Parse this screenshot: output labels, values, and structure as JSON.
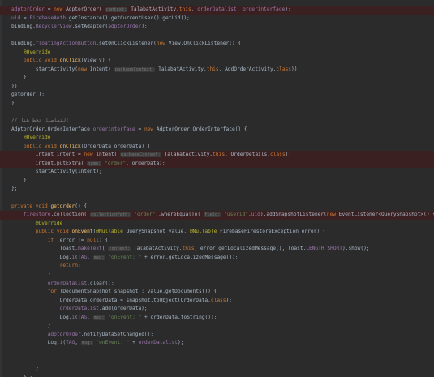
{
  "editor": {
    "lines": [
      [
        [
          "fld",
          "adptorOrder"
        ],
        [
          "p",
          " = "
        ],
        [
          "kw",
          "new "
        ],
        [
          "p",
          "AdptorOrder( "
        ],
        [
          "hint",
          "context:"
        ],
        [
          "p",
          " TalabatActivity."
        ],
        [
          "kw",
          "this"
        ],
        [
          "p",
          ", "
        ],
        [
          "fld",
          "orderDatalist"
        ],
        [
          "p",
          ", "
        ],
        [
          "fld",
          "orderinterface"
        ],
        [
          "p",
          ");"
        ]
      ],
      [
        [
          "fld",
          "uid"
        ],
        [
          "p",
          " = "
        ],
        [
          "fld",
          "FirebaseAuth"
        ],
        [
          "p",
          "."
        ],
        [
          "fn",
          ""
        ],
        [
          "p",
          "getInstance().getCurrentUser().getUid();"
        ]
      ],
      [
        [
          "p",
          "binding."
        ],
        [
          "fld",
          "RecyclerView"
        ],
        [
          "p",
          ".setAdapter("
        ],
        [
          "fld",
          "adptorOrder"
        ],
        [
          "p",
          ");"
        ]
      ],
      [
        [
          "p",
          ""
        ]
      ],
      [
        [
          "p",
          "binding."
        ],
        [
          "fld",
          "floatingActionButton"
        ],
        [
          "p",
          ".setOnClickListener("
        ],
        [
          "kw",
          "new "
        ],
        [
          "p",
          "View.OnClickListener() {"
        ]
      ],
      [
        [
          "ann",
          "    @Override"
        ]
      ],
      [
        [
          "kw",
          "    public void "
        ],
        [
          "fn",
          "onClick"
        ],
        [
          "p",
          "(View v) {"
        ]
      ],
      [
        [
          "p",
          "        startActivity("
        ],
        [
          "kw",
          "new "
        ],
        [
          "p",
          "Intent( "
        ],
        [
          "hint",
          "packageContext:"
        ],
        [
          "p",
          " TalabatActivity."
        ],
        [
          "kw",
          "this"
        ],
        [
          "p",
          ", AddOrderActivity."
        ],
        [
          "kw",
          "class"
        ],
        [
          "p",
          "));"
        ]
      ],
      [
        [
          "p",
          "    }"
        ]
      ],
      [
        [
          "p",
          "});"
        ]
      ],
      [
        [
          "p",
          "getorder();"
        ],
        [
          "caret",
          ""
        ]
      ],
      [
        [
          "p",
          "}"
        ]
      ],
      [
        [
          "p",
          ""
        ]
      ],
      [
        [
          "cmt",
          "// التفاصيل تحط هنا"
        ]
      ],
      [
        [
          "p",
          "AdptorOrder.OrderInterface "
        ],
        [
          "fld",
          "orderinterface"
        ],
        [
          "p",
          " = "
        ],
        [
          "kw",
          "new "
        ],
        [
          "p",
          "AdptorOrder.OrderInterface() {"
        ]
      ],
      [
        [
          "ann",
          "    @Override"
        ]
      ],
      [
        [
          "kw",
          "    public void "
        ],
        [
          "fn",
          "onClick"
        ],
        [
          "p",
          "(OrderData orderData) {"
        ]
      ],
      [
        [
          "p",
          "        Intent intent = "
        ],
        [
          "kw",
          "new "
        ],
        [
          "p",
          "Intent( "
        ],
        [
          "hint",
          "packageContext:"
        ],
        [
          "p",
          " TalabatActivity."
        ],
        [
          "kw",
          "this"
        ],
        [
          "p",
          ", OrderDetails."
        ],
        [
          "kw",
          "class"
        ],
        [
          "p",
          ");"
        ]
      ],
      [
        [
          "p",
          "        intent.putExtra( "
        ],
        [
          "hint",
          "name:"
        ],
        [
          "str",
          " \"order\""
        ],
        [
          "p",
          ", orderData);"
        ]
      ],
      [
        [
          "p",
          "        startActivity(intent);"
        ]
      ],
      [
        [
          "p",
          "    }"
        ]
      ],
      [
        [
          "p",
          "};"
        ]
      ],
      [
        [
          "p",
          ""
        ]
      ],
      [
        [
          "kw",
          "private void "
        ],
        [
          "fn",
          "getorder"
        ],
        [
          "p",
          "() {"
        ]
      ],
      [
        [
          "fld",
          "    firestore"
        ],
        [
          "p",
          ".collection( "
        ],
        [
          "hint",
          "collectionPath:"
        ],
        [
          "str",
          " \"order\""
        ],
        [
          "p",
          ").whereEqualTo( "
        ],
        [
          "hint",
          "field:"
        ],
        [
          "str",
          " \"userid\""
        ],
        [
          "p",
          ","
        ],
        [
          "fld",
          "uid"
        ],
        [
          "p",
          ").addSnapshotListener("
        ],
        [
          "kw",
          "new "
        ],
        [
          "p",
          "EventListener<QuerySnapshot>() {"
        ]
      ],
      [
        [
          "ann",
          "        @Override"
        ]
      ],
      [
        [
          "kw",
          "        public void "
        ],
        [
          "fn",
          "onEvent"
        ],
        [
          "p",
          "("
        ],
        [
          "ann",
          "@Nullable"
        ],
        [
          "p",
          " QuerySnapshot value, "
        ],
        [
          "ann",
          "@Nullable"
        ],
        [
          "p",
          " FirebaseFirestoreException error) {"
        ]
      ],
      [
        [
          "kw",
          "            if "
        ],
        [
          "p",
          "(error != "
        ],
        [
          "kw",
          "null"
        ],
        [
          "p",
          ") {"
        ]
      ],
      [
        [
          "p",
          "                Toast."
        ],
        [
          "fld",
          "makeText"
        ],
        [
          "p",
          "( "
        ],
        [
          "hint",
          "context:"
        ],
        [
          "p",
          " TalabatActivity."
        ],
        [
          "kw",
          "this"
        ],
        [
          "p",
          ", error.getLocalizedMessage(), Toast."
        ],
        [
          "fld",
          "LENGTH_SHORT"
        ],
        [
          "p",
          ").show();"
        ]
      ],
      [
        [
          "p",
          "                Log."
        ],
        [
          "fld",
          "i"
        ],
        [
          "p",
          "("
        ],
        [
          "fld",
          "TAG"
        ],
        [
          "p",
          ", "
        ],
        [
          "hint",
          "msg:"
        ],
        [
          "str",
          " \"onEvent: \""
        ],
        [
          "p",
          " + error.getLocalizedMessage());"
        ]
      ],
      [
        [
          "kw",
          "                return"
        ],
        [
          "p",
          ";"
        ]
      ],
      [
        [
          "p",
          "            }"
        ]
      ],
      [
        [
          "fld",
          "            orderDatalist"
        ],
        [
          "p",
          ".clear();"
        ]
      ],
      [
        [
          "kw",
          "            for "
        ],
        [
          "p",
          "(DocumentSnapshot snapshot : value.getDocuments()) {"
        ]
      ],
      [
        [
          "p",
          "                OrderData orderData = snapshot.toObject(OrderData."
        ],
        [
          "kw",
          "class"
        ],
        [
          "p",
          ");"
        ]
      ],
      [
        [
          "fld",
          "                orderDatalist"
        ],
        [
          "p",
          ".add(orderData);"
        ]
      ],
      [
        [
          "p",
          "                Log."
        ],
        [
          "fld",
          "i"
        ],
        [
          "p",
          "("
        ],
        [
          "fld",
          "TAG"
        ],
        [
          "p",
          ", "
        ],
        [
          "hint",
          "msg:"
        ],
        [
          "str",
          " \"onEvent: \""
        ],
        [
          "p",
          " + orderData.toString());"
        ]
      ],
      [
        [
          "p",
          "            }"
        ]
      ],
      [
        [
          "fld",
          "            adptorOrder"
        ],
        [
          "p",
          ".notifyDataSetChanged();"
        ]
      ],
      [
        [
          "p",
          "            Log."
        ],
        [
          "fld",
          "i"
        ],
        [
          "p",
          "("
        ],
        [
          "fld",
          "TAG"
        ],
        [
          "p",
          ", "
        ],
        [
          "hint",
          "msg:"
        ],
        [
          "str",
          " \"onEvent: \""
        ],
        [
          "p",
          " + "
        ],
        [
          "fld",
          "orderDatalist"
        ],
        [
          "p",
          ");"
        ]
      ],
      [
        [
          "p",
          ""
        ]
      ],
      [
        [
          "p",
          ""
        ]
      ],
      [
        [
          "p",
          "        }"
        ]
      ],
      [
        [
          "p",
          "    });"
        ]
      ]
    ],
    "highlighted_lines": [
      0,
      17,
      18,
      24
    ]
  }
}
